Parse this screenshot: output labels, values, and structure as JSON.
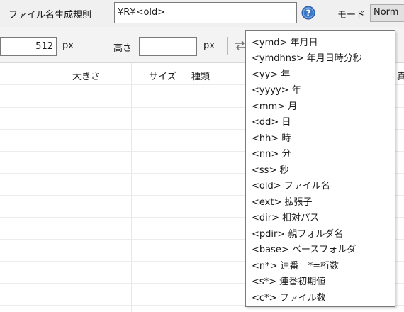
{
  "top": {
    "filename_rule_label": "ファイル名生成規則",
    "filename_rule_value": "¥R¥<old>",
    "help_icon": "help-icon",
    "mode_label": "モード",
    "mode_value": "Norm"
  },
  "toolbar": {
    "width_value": "512",
    "width_unit": "px",
    "height_label": "高さ",
    "height_value": "",
    "height_unit": "px",
    "swap_icon": "swap-icon"
  },
  "columns": [
    "大きさ",
    "サイズ",
    "種類",
    "真"
  ],
  "popup_items": [
    "<ymd> 年月日",
    "<ymdhns> 年月日時分秒",
    "<yy> 年",
    "<yyyy> 年",
    "<mm> 月",
    "<dd> 日",
    "<hh> 時",
    "<nn> 分",
    "<ss> 秒",
    "<old> ファイル名",
    "<ext> 拡張子",
    "<dir> 相対パス",
    "<pdir> 親フォルダ名",
    "<base> ベースフォルダ",
    "<n*> 連番　*=桁数",
    "<s*> 連番初期値",
    "<c*> ファイル数"
  ],
  "colors": {
    "help_icon_blue": "#3c78c8",
    "popup_border": "#7a7a7a"
  }
}
